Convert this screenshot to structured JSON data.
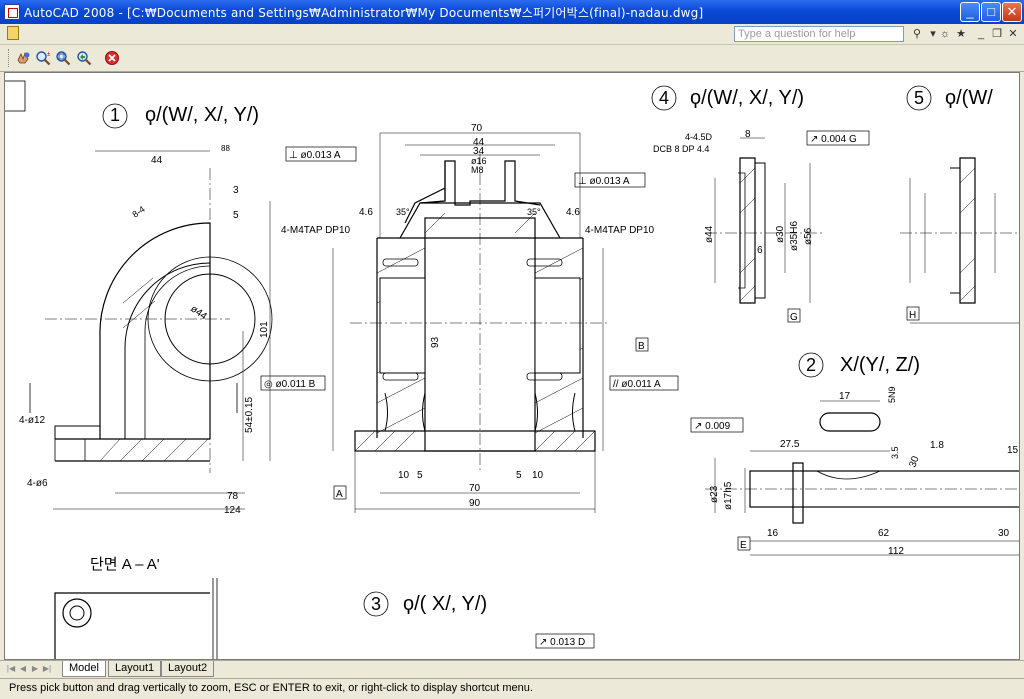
{
  "window": {
    "title": "AutoCAD 2008 - [C:₩Documents and Settings₩Administrator₩My Documents₩스퍼기어박스(final)-nadau.dwg]"
  },
  "menubar": {
    "help_placeholder": "Type a question for help"
  },
  "toolbar": {
    "icons": [
      "pan-realtime-icon",
      "zoom-realtime-icon",
      "zoom-window-icon",
      "zoom-previous-icon",
      "close-icon"
    ]
  },
  "drawing": {
    "view1": {
      "number": "1",
      "symbol": "ϙ/(W/, X/, Y/)"
    },
    "view2": {
      "number": "2",
      "symbol": "X/(Y/, Z/)"
    },
    "view3": {
      "number": "3",
      "symbol": "ϙ/( X/, Y/)"
    },
    "view4": {
      "number": "4",
      "symbol": "ϙ/(W/, X/, Y/)"
    },
    "view5": {
      "number": "5",
      "symbol": "ϙ/(W/"
    },
    "section_label": "단면 A – A'",
    "tol_perp_a": "⊥ ø0.013 A",
    "tol_perp_a2": "⊥ ø0.013 A",
    "tol_conc_b": "◎ ø0.011 B",
    "tol_par_a": "// ø0.011 A",
    "tol_runout_g": "↗ 0.004 G",
    "tol_runout_009": "↗ 0.009",
    "tol_runout_d": "↗ 0.013 D",
    "datum_a": "A",
    "datum_b": "B",
    "datum_g": "G",
    "datum_h": "H",
    "datum_e": "E",
    "tap_left": "4-M4TAP DP10",
    "tap_right": "4-M4TAP DP10",
    "dcb_note": "DCB 8 DP 4.4",
    "hole_note": "4-4.5D",
    "dim": {
      "d70_top": "70",
      "d44_top": "44",
      "d34": "34",
      "d16": "ø16",
      "m8": "M8",
      "d46l": "4.6",
      "d35l": "35°",
      "d35r": "35°",
      "d46r": "4.6",
      "d93": "93",
      "d70_bot": "70",
      "d90": "90",
      "d10a": "10",
      "d5a": "5",
      "d5b": "5",
      "d10b": "10",
      "d44_left": "44",
      "d88": "88",
      "d101": "101",
      "d54": "54±0.15",
      "d78": "78",
      "d124": "124",
      "d4phi12": "4-ø12",
      "d4phi6": "4-ø6",
      "d3": "3",
      "d5": "5",
      "d8_4": "8-4",
      "dphi44": "ø44",
      "d27_5": "27.5",
      "d17": "17",
      "d5n9": "5N9",
      "d1_8": "1.8",
      "d15": "15",
      "d30": "30",
      "d16s": "16",
      "d62": "62",
      "d112": "112",
      "d30r": "30",
      "d3_5": "3.5",
      "dphi23": "ø23",
      "dphi17h5": "ø17h5",
      "d8v4": "8",
      "dphi44v4": "ø44",
      "dphi30": "ø30",
      "dphi35h6": "ø35H6",
      "dphi56": "ø56",
      "d6": "6"
    }
  },
  "tabs": [
    "Model",
    "Layout1",
    "Layout2"
  ],
  "status": "Press pick button and drag vertically to zoom, ESC or ENTER to exit, or right-click to display shortcut menu."
}
